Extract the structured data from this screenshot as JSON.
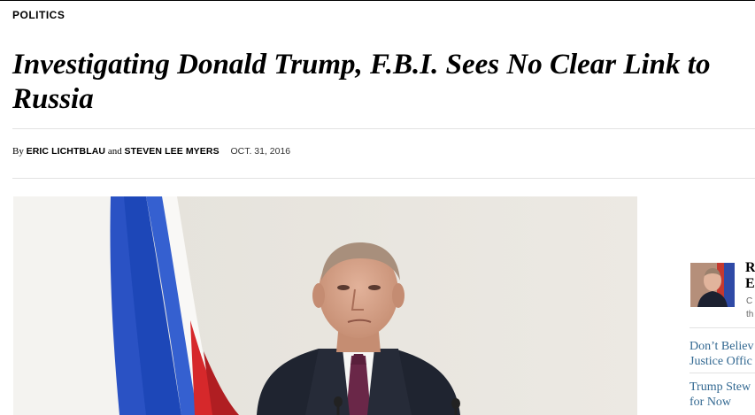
{
  "article": {
    "section": "POLITICS",
    "headline": "Investigating Donald Trump, F.B.I. Sees No Clear Link to Russia",
    "byline_prefix": "By",
    "author_1": "ERIC LICHTBLAU",
    "byline_conjunction": "and",
    "author_2": "STEVEN LEE MYERS",
    "date": "OCT. 31, 2016"
  },
  "sidebar": {
    "related_title_line1": "R",
    "related_title_line2": "E",
    "related_summary_line1": "C",
    "related_summary_line2": "th",
    "links": [
      {
        "line1": "Don’t Believ",
        "line2": "Justice Offic"
      },
      {
        "line1": "Trump Stew",
        "line2": "for Now"
      }
    ]
  },
  "colors": {
    "link": "#326891",
    "rule": "#e2e2e2",
    "flag_white": "#f4f3f0",
    "flag_blue": "#1d47b8",
    "flag_red": "#d6282b"
  }
}
